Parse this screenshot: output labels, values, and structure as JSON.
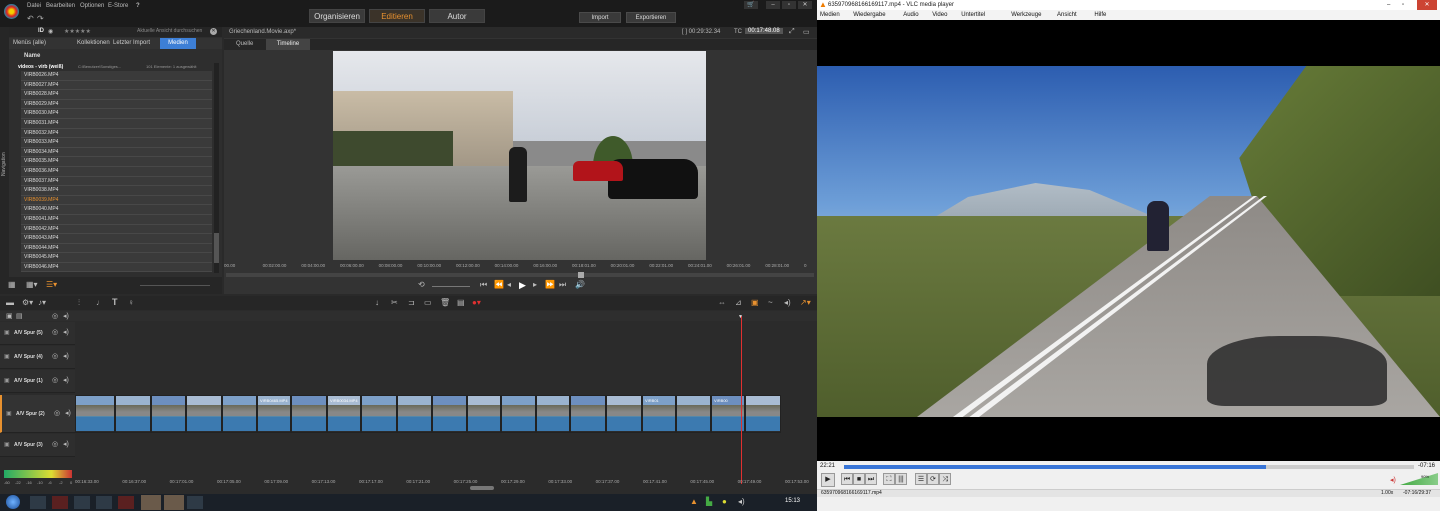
{
  "pinnacle": {
    "menu": [
      "Datei",
      "Bearbeiten",
      "Optionen",
      "E-Store",
      "?"
    ],
    "modes": [
      "Organisieren",
      "Editieren",
      "Autor"
    ],
    "active_mode": "Editieren",
    "import_label": "Import",
    "export_label": "Exportieren",
    "library": {
      "id_label": "ID",
      "stars": "★★★★★",
      "search_placeholder": "Aktuelle Ansicht durchsuchen",
      "tabs": [
        "Menüs (alle)",
        "Kollektionen",
        "Letzter Import",
        "Medien"
      ],
      "active_tab": "Medien",
      "column_name": "Name",
      "folder": "videos - virb (weiß)",
      "folder_path": "C:\\Benutzer\\Sonstiges...",
      "folder_info": "101 Elemente: 1 ausgewählt",
      "files": [
        "VIRB0026.MP4",
        "VIRB0027.MP4",
        "VIRB0028.MP4",
        "VIRB0029.MP4",
        "VIRB0030.MP4",
        "VIRB0031.MP4",
        "VIRB0032.MP4",
        "VIRB0033.MP4",
        "VIRB0034.MP4",
        "VIRB0035.MP4",
        "VIRB0036.MP4",
        "VIRB0037.MP4",
        "VIRB0038.MP4",
        "VIRB0039.MP4",
        "VIRB0040.MP4",
        "VIRB0041.MP4",
        "VIRB0042.MP4",
        "VIRB0043.MP4",
        "VIRB0044.MP4",
        "VIRB0045.MP4",
        "VIRB0046.MP4"
      ],
      "selected_file": "VIRB0039.MP4",
      "nav_label": "Navigation"
    },
    "preview": {
      "project": "Griechenland.Movie.axp*",
      "duration": "[ ] 00:29:32.34",
      "tc_label": "TC",
      "timecode": "00:17:48.08",
      "tabs": [
        "Quelle",
        "Timeline"
      ],
      "active_tab": "Timeline",
      "ruler": [
        "00.00",
        "00:02:00.00",
        "00:04:00.00",
        "00:06:00.00",
        "00:08:00.00",
        "00:10:00.00",
        "00:12:00.00",
        "00:14:00.00",
        "00:16:00.00",
        "00:18:01.00",
        "00:20:01.00",
        "00:22:01.00",
        "00:24:01.00",
        "00:26:01.00",
        "00:28:01.00",
        "0"
      ]
    },
    "tracks": [
      "A/V Spur (5)",
      "A/V Spur (4)",
      "A/V Spur (1)",
      "A/V Spur (2)",
      "A/V Spur (3)"
    ],
    "clip_labels": [
      "VIRB0465.MP4",
      "VIRB0034.MP4",
      "VIRB01",
      "VIRB00"
    ],
    "timeline_ruler": [
      "00:16:33.00",
      "00:16:37.00",
      "00:17:01.00",
      "00:17:05.00",
      "00:17:09.00",
      "00:17:13.00",
      "00:17:17.00",
      "00:17:21.00",
      "00:17:25.00",
      "00:17:29.00",
      "00:17:33.00",
      "00:17:37.00",
      "00:17:41.00",
      "00:17:45.00",
      "00:17:49.00",
      "00:17:53.00"
    ],
    "meter": [
      "-60",
      "-22",
      "-16",
      "-10",
      "-6",
      "-2",
      "0"
    ],
    "clock": "15:13"
  },
  "vlc": {
    "title": "635970968166169117.mp4 - VLC media player",
    "menu": [
      "Medien",
      "Wiedergabe",
      "Audio",
      "Video",
      "Untertitel",
      "Werkzeuge",
      "Ansicht",
      "Hilfe"
    ],
    "elapsed": "22:21",
    "remaining": "-07:16",
    "progress": 0.74,
    "status_file": "635970968166169117.mp4",
    "speed": "1.00x",
    "time_status": "-07:16/29:37",
    "volume": "90%"
  },
  "colors": {
    "accent": "#e8912f",
    "media_tab": "#3d7fd6",
    "playhead": "#e03030",
    "vlc_progress": "#3875d7"
  }
}
